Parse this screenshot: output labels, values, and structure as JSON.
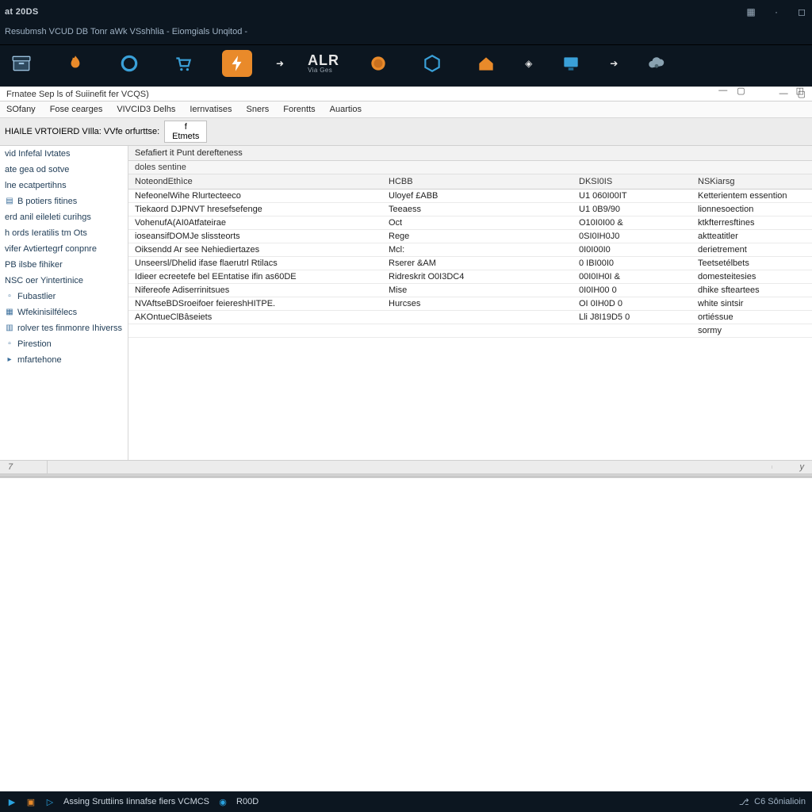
{
  "topbar": {
    "product": "at 20DS",
    "breadcrumb": "Resubmsh VCUD DB Tonr aWk VSshhlia  -  Eiomgials Unqitod  -"
  },
  "ribbon": {
    "alr_main": "ALR",
    "alr_sub": "Via Ges"
  },
  "chrome": {
    "title": "Frnatee Sep ls of Suiinefit fer VCQS)"
  },
  "menu": {
    "items": [
      "SOfany",
      "Fose cearges",
      "VIVCID3 Delhs",
      "Iernvatises",
      "Sners",
      "Forentts",
      "Auartios"
    ]
  },
  "toolbar": {
    "label": "HIAILE VRTOIERD VIlla: VVfe orfurttse:",
    "btn": "f Etmets"
  },
  "sidebar": {
    "items": [
      "vid Infefal Ivtates",
      "ate gea od sotve",
      "lne ecatpertihns",
      "B potiers fitines",
      "erd anil eileleti curihgs",
      "h ords Ieratilis tm Ots",
      "vifer Avtiertegrf conpnre",
      "PB ilsbe fihiker",
      "NSC oer Yintertinice",
      "Fubastlier",
      "Wfekinisilfélecs",
      "rolver tes finmonre Ihiverss",
      "Pirestion",
      "mfartehone"
    ]
  },
  "content": {
    "section_head": "Sefafiert it Punt derefteness",
    "section_sub": "doles sentine",
    "columns": [
      "NoteondEthìce",
      "HCBB",
      "DKSI0IS",
      "NSKiarsg"
    ],
    "rows": [
      [
        "NefeonelWihe Rlurtecteeco",
        "Uloyef £ABB",
        "U1 060I00IT",
        "Ketterientem essention"
      ],
      [
        "Tiekaord DJPNVT hresefsefenge",
        "Teeaess",
        "U1 0B9/90",
        "lionnesoection"
      ],
      [
        "VohenufA(AI0Atfateirae",
        "Oct",
        "O10I0I00  &",
        "ktkfterresftines"
      ],
      [
        "ioseansifDOMJe slissteorts",
        "Rege",
        "0SI0IH0J0",
        "aktteatitler"
      ],
      [
        "Oiksendd Ar see Nehiediertazes",
        "Mcl:",
        "0I0I00I0",
        "derietrement"
      ],
      [
        "Unseersl/Dhelid ifase flaerutrl Rtilacs",
        "Rserer &AM",
        "0 IBI00I0",
        "Teetsetélbets"
      ],
      [
        "Idieer ecreetefe bel EEntatise ifin as60DE",
        "Ridreskrit O0I3DC4",
        "00I0IH0I  &",
        "domesteitesies"
      ],
      [
        "Nifereofe Adiserrinitsues",
        "Mise",
        "0I0IH00  0",
        "dhike sfteartees"
      ],
      [
        "NVAftseBDSroeifoer feiereshHITPE.",
        "Hurcses",
        "OI  0IH0D  0",
        "white sintsir"
      ],
      [
        "AKOntueClBâseiets",
        "",
        "Lli J8I19D5   0",
        "ortiéssue"
      ],
      [
        "",
        "",
        "",
        "sormy"
      ]
    ]
  },
  "statusbar": {
    "left": "7",
    "right": "y"
  },
  "taskbar": {
    "left_label": "Assing Sruttiins Iinnafse fiers VCMCS",
    "left_badge": "R00D",
    "right_label": "C6 Sônialioin"
  }
}
